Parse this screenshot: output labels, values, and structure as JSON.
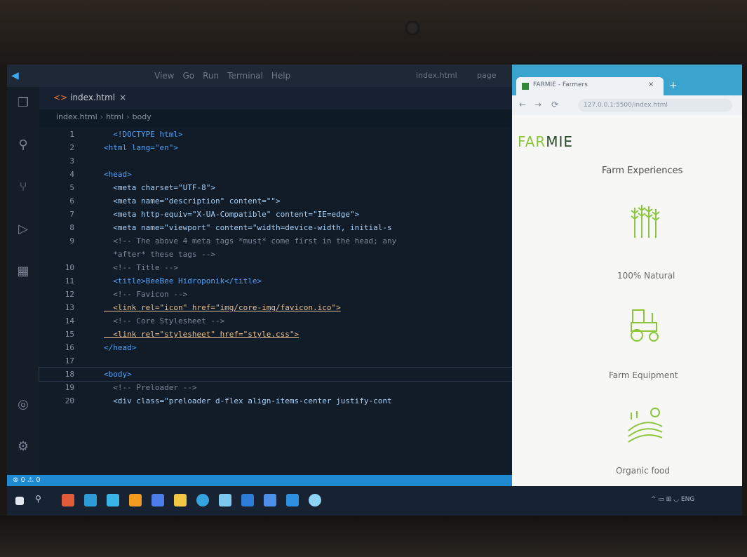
{
  "vscode": {
    "menu": [
      "View",
      "Go",
      "Run",
      "Terminal",
      "Help"
    ],
    "title_file": "index.html",
    "title_page": "page",
    "tab_label": "index.html",
    "tab_close": "×",
    "breadcrumb": [
      "index.html",
      "html",
      "body"
    ],
    "lines": [
      {
        "n": "1",
        "text": "  <!DOCTYPE html>"
      },
      {
        "n": "2",
        "text": "<html lang=\"en\">"
      },
      {
        "n": "3",
        "text": ""
      },
      {
        "n": "4",
        "text": "<head>"
      },
      {
        "n": "5",
        "text": "  <meta charset=\"UTF-8\">"
      },
      {
        "n": "6",
        "text": "  <meta name=\"description\" content=\"\">"
      },
      {
        "n": "7",
        "text": "  <meta http-equiv=\"X-UA-Compatible\" content=\"IE=edge\">"
      },
      {
        "n": "8",
        "text": "  <meta name=\"viewport\" content=\"width=device-width, initial-s"
      },
      {
        "n": "9",
        "text": "  <!-- The above 4 meta tags *must* come first in the head; any"
      },
      {
        "n": "",
        "text": "  *after* these tags -->"
      },
      {
        "n": "10",
        "text": "  <!-- Title -->"
      },
      {
        "n": "11",
        "text": "  <title>BeeBee Hidroponik</title>"
      },
      {
        "n": "12",
        "text": "  <!-- Favicon -->"
      },
      {
        "n": "13",
        "text": "  <link rel=\"icon\" href=\"img/core-img/favicon.ico\">"
      },
      {
        "n": "14",
        "text": "  <!-- Core Stylesheet -->"
      },
      {
        "n": "15",
        "text": "  <link rel=\"stylesheet\" href=\"style.css\">"
      },
      {
        "n": "16",
        "text": "</head>"
      },
      {
        "n": "17",
        "text": ""
      },
      {
        "n": "18",
        "text": "<body>"
      },
      {
        "n": "19",
        "text": "  <!-- Preloader -->"
      },
      {
        "n": "20",
        "text": "  <div class=\"preloader d-flex align-items-center justify-cont"
      }
    ],
    "status_text": "⊗ 0 ⚠ 0"
  },
  "browser": {
    "tab_title": "FARMIE - Farmers",
    "tab_close": "×",
    "new_tab": "+",
    "url": "127.0.0.1:5500/index.html",
    "logo_a": "FAR",
    "logo_b": "MIE",
    "section_title": "Farm Experiences",
    "features": [
      {
        "label": "100% Natural",
        "icon": "wheat-icon"
      },
      {
        "label": "Farm Equipment",
        "icon": "tractor-icon"
      },
      {
        "label": "Organic food",
        "icon": "field-icon"
      }
    ]
  },
  "colors": {
    "accent_green": "#8cc63f",
    "vscode_blue": "#1f8ad2",
    "browser_blue": "#3aa3ce"
  }
}
